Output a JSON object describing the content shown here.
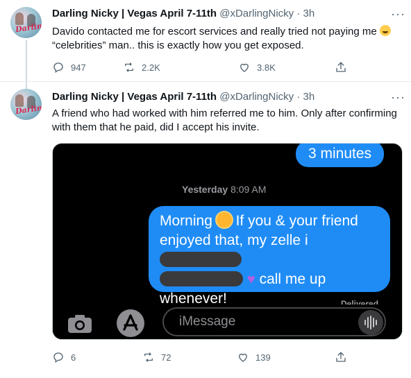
{
  "tweets": [
    {
      "name": "Darling Nicky | Vegas April 7-11th",
      "handle": "@xDarlingNicky",
      "dot": "·",
      "time": "3h",
      "more": "···",
      "text_before_emoji": "Davido contacted me for escort services and really tried not paying me",
      "text_after_emoji": "“celebrities” man.. this is exactly how you get exposed.",
      "replies": "947",
      "retweets": "2.2K",
      "likes": "3.8K"
    },
    {
      "name": "Darling Nicky | Vegas April 7-11th",
      "handle": "@xDarlingNicky",
      "dot": "·",
      "time": "3h",
      "more": "···",
      "text": "A friend who had worked with him referred me to him. Only after confirming with them that he paid, did I accept his invite.",
      "replies": "6",
      "retweets": "72",
      "likes": "139"
    }
  ],
  "avatar_scrawl": "Darling",
  "imessage": {
    "top_bubble": "3 minutes",
    "timestamp_day": "Yesterday",
    "timestamp_time": "8:09 AM",
    "line1_a": "Morning",
    "line1_b": "If you & your friend",
    "line2": "enjoyed that, my zelle i",
    "line3_tail": "call me up",
    "line4": "whenever!",
    "delivered": "Delivered",
    "input_placeholder": "iMessage"
  },
  "icons": {
    "reply": "reply-icon",
    "retweet": "retweet-icon",
    "like": "heart-icon",
    "share": "share-icon",
    "camera": "camera-icon",
    "apps": "app-store-icon",
    "audio": "audio-waveform-icon"
  },
  "colors": {
    "imessage_blue": "#1f8cf6",
    "text_secondary": "#536471",
    "divider": "#e6ecf0"
  }
}
